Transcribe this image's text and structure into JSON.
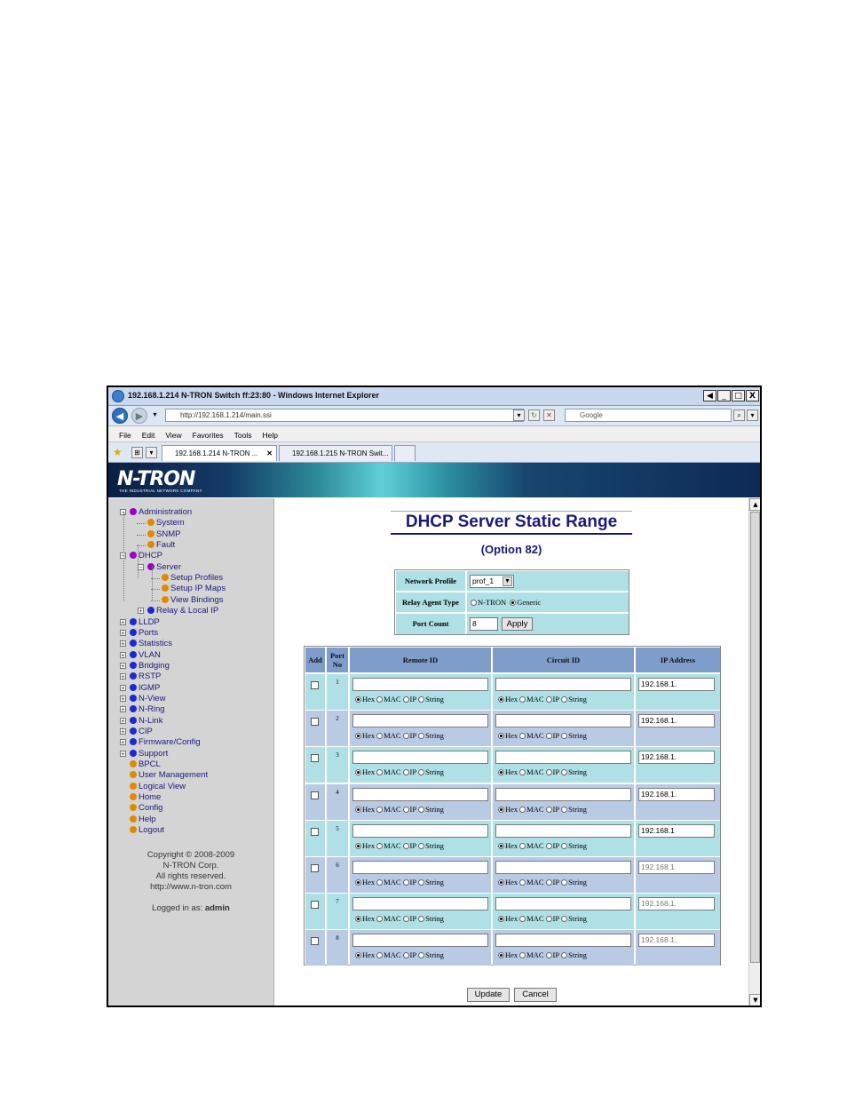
{
  "window": {
    "title": "192.168.1.214 N-TRON Switch ff:23:80 - Windows Internet Explorer",
    "min_label": "_",
    "max_label": "□",
    "close_label": "X",
    "back_arrow": "◀",
    "url": "http://192.168.1.214/main.ssi",
    "search_placeholder": "Google",
    "menu": [
      "File",
      "Edit",
      "View",
      "Favorites",
      "Tools",
      "Help"
    ],
    "tabs": [
      "192.168.1.214 N-TRON ...",
      "192.168.1.215 N-TRON Swit..."
    ]
  },
  "banner": {
    "logo": "N-TRON",
    "tagline": "THE INDUSTRIAL NETWORK COMPANY"
  },
  "sidebar": {
    "items": [
      {
        "label": "Administration",
        "color": "#9a00c8"
      },
      {
        "label": "System",
        "color": "#e08a00"
      },
      {
        "label": "SNMP",
        "color": "#e08a00"
      },
      {
        "label": "Fault",
        "color": "#e08a00"
      },
      {
        "label": "DHCP",
        "color": "#9a00c8"
      },
      {
        "label": "Server",
        "color": "#9a00c8"
      },
      {
        "label": "Setup Profiles",
        "color": "#e08a00"
      },
      {
        "label": "Setup IP Maps",
        "color": "#e08a00"
      },
      {
        "label": "View Bindings",
        "color": "#e08a00"
      },
      {
        "label": "Relay & Local IP",
        "color": "#1a2ad0"
      },
      {
        "label": "LLDP",
        "color": "#1a2ad0"
      },
      {
        "label": "Ports",
        "color": "#1a2ad0"
      },
      {
        "label": "Statistics",
        "color": "#1a2ad0"
      },
      {
        "label": "VLAN",
        "color": "#1a2ad0"
      },
      {
        "label": "Bridging",
        "color": "#1a2ad0"
      },
      {
        "label": "RSTP",
        "color": "#1a2ad0"
      },
      {
        "label": "IGMP",
        "color": "#1a2ad0"
      },
      {
        "label": "N-View",
        "color": "#1a2ad0"
      },
      {
        "label": "N-Ring",
        "color": "#1a2ad0"
      },
      {
        "label": "N-Link",
        "color": "#1a2ad0"
      },
      {
        "label": "CIP",
        "color": "#1a2ad0"
      },
      {
        "label": "Firmware/Config",
        "color": "#1a2ad0"
      },
      {
        "label": "Support",
        "color": "#1a2ad0"
      },
      {
        "label": "BPCL",
        "color": "#e08a00"
      },
      {
        "label": "User Management",
        "color": "#e08a00"
      },
      {
        "label": "Logical View",
        "color": "#e08a00"
      },
      {
        "label": "Home",
        "color": "#e08a00"
      },
      {
        "label": "Config",
        "color": "#e08a00"
      },
      {
        "label": "Help",
        "color": "#e08a00"
      },
      {
        "label": "Logout",
        "color": "#e08a00"
      }
    ],
    "copyright": "Copyright © 2008-2009",
    "company": "N-TRON Corp.",
    "rights": "All rights reserved.",
    "site": "http://www.n-tron.com",
    "logged_in_label": "Logged in as:",
    "user": "admin"
  },
  "page": {
    "title": "DHCP Server Static Range",
    "subtitle": "(Option 82)",
    "config": {
      "network_profile_label": "Network Profile",
      "network_profile_value": "prof_1",
      "relay_agent_label": "Relay Agent Type",
      "relay_options": [
        "N-TRON",
        "Generic"
      ],
      "relay_selected": "Generic",
      "port_count_label": "Port Count",
      "port_count_value": "8",
      "apply_label": "Apply"
    },
    "table": {
      "headers": [
        "Add",
        "Port No",
        "Remote ID",
        "Circuit ID",
        "IP Address"
      ],
      "format_options": [
        "Hex",
        "MAC",
        "IP",
        "String"
      ],
      "rows": [
        {
          "port": "1",
          "remote_fmt": "Hex",
          "circuit_fmt": "Hex",
          "ip": "192.168.1."
        },
        {
          "port": "2",
          "remote_fmt": "Hex",
          "circuit_fmt": "Hex",
          "ip": "192.168.1."
        },
        {
          "port": "3",
          "remote_fmt": "Hex",
          "circuit_fmt": "Hex",
          "ip": "192.168.1."
        },
        {
          "port": "4",
          "remote_fmt": "Hex",
          "circuit_fmt": "Hex",
          "ip": "192.168.1."
        },
        {
          "port": "5",
          "remote_fmt": "Hex",
          "circuit_fmt": "Hex",
          "ip": "192.168.1"
        },
        {
          "port": "6",
          "remote_fmt": "Hex",
          "circuit_fmt": "Hex",
          "ip": "192.168.1"
        },
        {
          "port": "7",
          "remote_fmt": "Hex",
          "circuit_fmt": "Hex",
          "ip": "192.168.1."
        },
        {
          "port": "8",
          "remote_fmt": "Hex",
          "circuit_fmt": "Hex",
          "ip": "192.168.1."
        }
      ]
    },
    "update_label": "Update",
    "cancel_label": "Cancel"
  }
}
